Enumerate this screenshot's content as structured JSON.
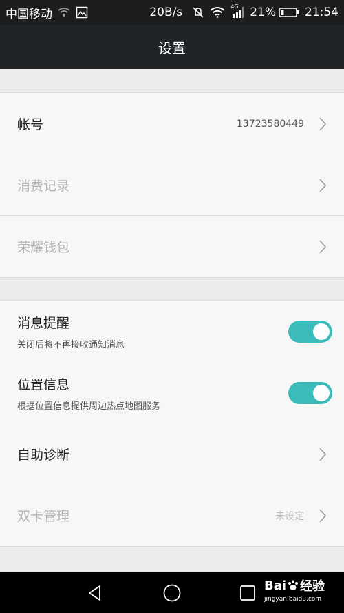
{
  "status_bar": {
    "carrier": "中国移动",
    "speed": "20B/s",
    "network_badge": "4G",
    "battery_percent": "21%",
    "battery_level": 0.21,
    "time": "21:54"
  },
  "title": "设置",
  "account_group": {
    "account": {
      "label": "帐号",
      "value": "13723580449"
    },
    "consumption": {
      "label": "消费记录"
    },
    "wallet": {
      "label": "荣耀钱包"
    }
  },
  "notification_group": {
    "message_reminder": {
      "title": "消息提醒",
      "subtitle": "关闭后将不再接收通知消息",
      "enabled": true
    },
    "location_info": {
      "title": "位置信息",
      "subtitle": "根据位置信息提供周边热点地图服务",
      "enabled": true
    },
    "self_diagnosis": {
      "label": "自助诊断"
    },
    "dual_sim": {
      "label": "双卡管理",
      "value": "未设定"
    }
  },
  "colors": {
    "accent": "#3bbcba",
    "title_bar": "#202427",
    "status_bar": "#1b1d1e"
  },
  "watermark": {
    "brand": "Bai",
    "brand_suffix": "经验",
    "url": "jingyan.baidu.com"
  },
  "icons": {
    "status": [
      "wifi-signal-icon",
      "image-icon",
      "mute-icon",
      "wifi-icon",
      "cell-signal-icon",
      "battery-icon"
    ],
    "row": "chevron-right-icon",
    "nav": [
      "back-icon",
      "home-icon",
      "recents-icon"
    ],
    "watermark": "paw-icon"
  }
}
